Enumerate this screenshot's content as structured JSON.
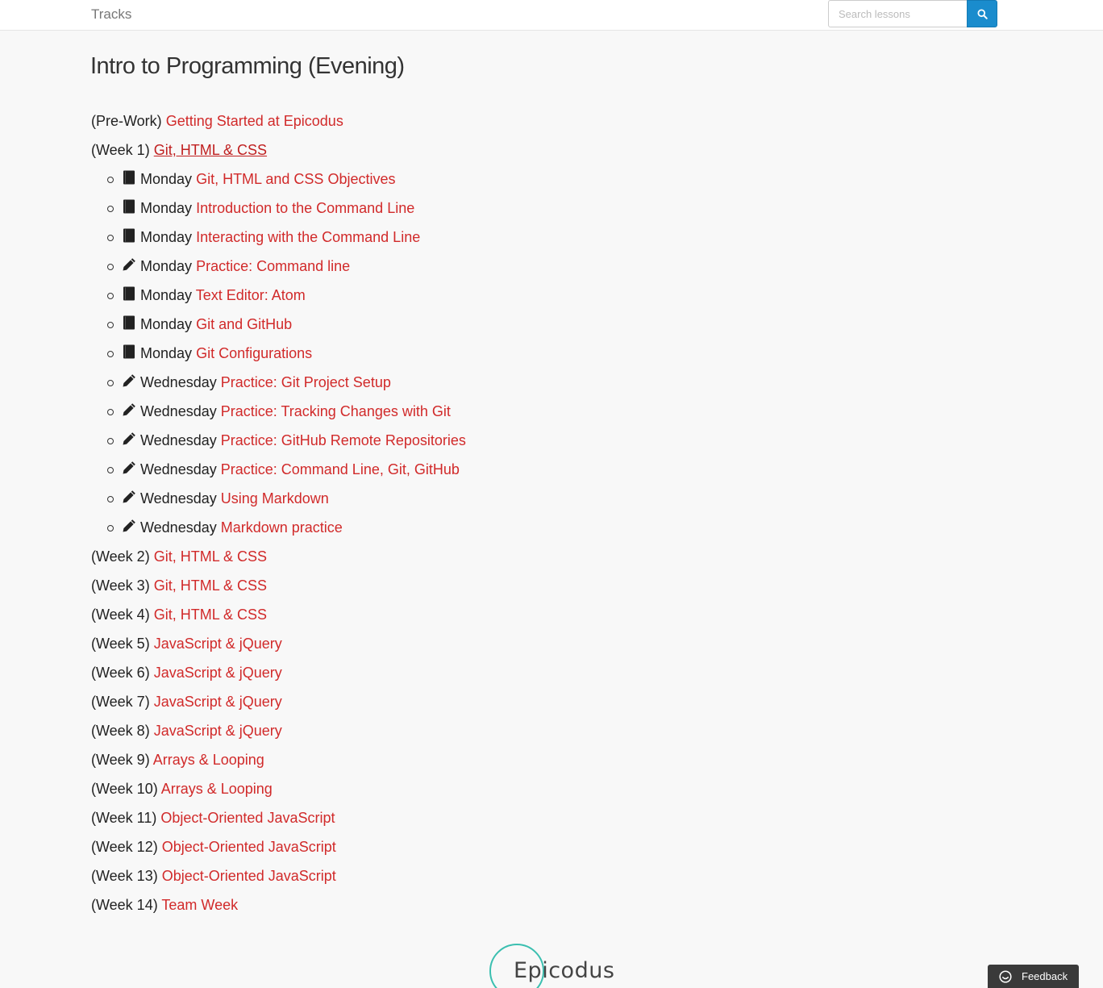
{
  "navbar": {
    "brand": "Tracks",
    "search_placeholder": "Search lessons",
    "search_icon": "search-icon"
  },
  "page_title": "Intro to Programming (Evening)",
  "weeks": [
    {
      "prefix": "(Pre-Work)",
      "title": "Getting Started at Epicodus"
    },
    {
      "prefix": "(Week 1)",
      "title": "Git, HTML & CSS",
      "expanded": true,
      "lessons": [
        {
          "icon": "book-icon",
          "day": "Monday",
          "title": "Git, HTML and CSS Objectives"
        },
        {
          "icon": "book-icon",
          "day": "Monday",
          "title": "Introduction to the Command Line"
        },
        {
          "icon": "book-icon",
          "day": "Monday",
          "title": "Interacting with the Command Line"
        },
        {
          "icon": "pencil-icon",
          "day": "Monday",
          "title": "Practice: Command line"
        },
        {
          "icon": "book-icon",
          "day": "Monday",
          "title": "Text Editor: Atom"
        },
        {
          "icon": "book-icon",
          "day": "Monday",
          "title": "Git and GitHub"
        },
        {
          "icon": "book-icon",
          "day": "Monday",
          "title": "Git Configurations"
        },
        {
          "icon": "pencil-icon",
          "day": "Wednesday",
          "title": "Practice: Git Project Setup"
        },
        {
          "icon": "pencil-icon",
          "day": "Wednesday",
          "title": "Practice: Tracking Changes with Git"
        },
        {
          "icon": "pencil-icon",
          "day": "Wednesday",
          "title": "Practice: GitHub Remote Repositories"
        },
        {
          "icon": "pencil-icon",
          "day": "Wednesday",
          "title": "Practice: Command Line, Git, GitHub"
        },
        {
          "icon": "pencil-icon",
          "day": "Wednesday",
          "title": "Using Markdown"
        },
        {
          "icon": "pencil-icon",
          "day": "Wednesday",
          "title": "Markdown practice"
        }
      ]
    },
    {
      "prefix": "(Week 2)",
      "title": "Git, HTML & CSS"
    },
    {
      "prefix": "(Week 3)",
      "title": "Git, HTML & CSS"
    },
    {
      "prefix": "(Week 4)",
      "title": "Git, HTML & CSS"
    },
    {
      "prefix": "(Week 5)",
      "title": "JavaScript & jQuery"
    },
    {
      "prefix": "(Week 6)",
      "title": "JavaScript & jQuery"
    },
    {
      "prefix": "(Week 7)",
      "title": "JavaScript & jQuery"
    },
    {
      "prefix": "(Week 8)",
      "title": "JavaScript & jQuery"
    },
    {
      "prefix": "(Week 9)",
      "title": "Arrays & Looping"
    },
    {
      "prefix": "(Week 10)",
      "title": "Arrays & Looping"
    },
    {
      "prefix": "(Week 11)",
      "title": "Object-Oriented JavaScript"
    },
    {
      "prefix": "(Week 12)",
      "title": "Object-Oriented JavaScript"
    },
    {
      "prefix": "(Week 13)",
      "title": "Object-Oriented JavaScript"
    },
    {
      "prefix": "(Week 14)",
      "title": "Team Week"
    }
  ],
  "footer": {
    "logo_text": "Epicodus"
  },
  "feedback": {
    "label": "Feedback",
    "icon": "feedback-icon"
  },
  "colors": {
    "link": "#d12a2a",
    "search_button": "#1a8ccd",
    "logo_ring": "#3bbfb0"
  }
}
